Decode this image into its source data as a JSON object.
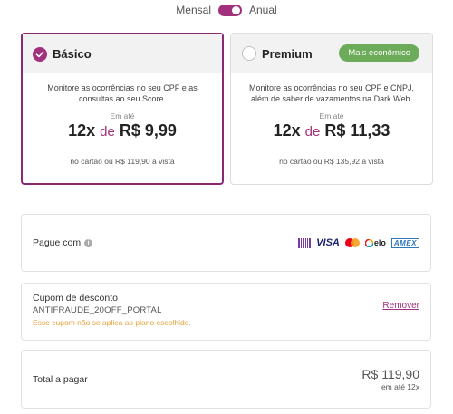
{
  "billing_toggle": {
    "left_label": "Mensal",
    "right_label": "Anual",
    "state": "Anual"
  },
  "plans": [
    {
      "name": "Básico",
      "selected": true,
      "description": "Monitore as ocorrências no seu CPF e as consultas ao seu Score.",
      "from_label": "Em até",
      "installments": "12x",
      "de": "de",
      "price": "R$ 9,99",
      "cash": "no cartão ou R$ 119,90 à vista"
    },
    {
      "name": "Premium",
      "selected": false,
      "badge": "Mais econômico",
      "description": "Monitore as ocorrências no seu CPF e CNPJ, além de saber de vazamentos na Dark Web.",
      "from_label": "Em até",
      "installments": "12x",
      "de": "de",
      "price": "R$ 11,33",
      "cash": "no cartão ou R$ 135,92 à vista"
    }
  ],
  "payment": {
    "label": "Pague com",
    "methods": [
      "barcode-icon",
      "VISA",
      "mastercard-icon",
      "elo",
      "AMEX"
    ],
    "visa": "VISA",
    "elo": "elo",
    "amex": "AMEX"
  },
  "coupon": {
    "title": "Cupom de desconto",
    "code": "ANTIFRAUDE_20OFF_PORTAL",
    "warning": "Esse cupom não se aplica ao plano escolhido.",
    "remove_label": "Remover"
  },
  "total": {
    "label": "Total a pagar",
    "price": "R$ 119,90",
    "installments": "em até 12x"
  },
  "colors": {
    "accent": "#a3307c",
    "badge": "#6bab59",
    "warning": "#e8a23b"
  }
}
